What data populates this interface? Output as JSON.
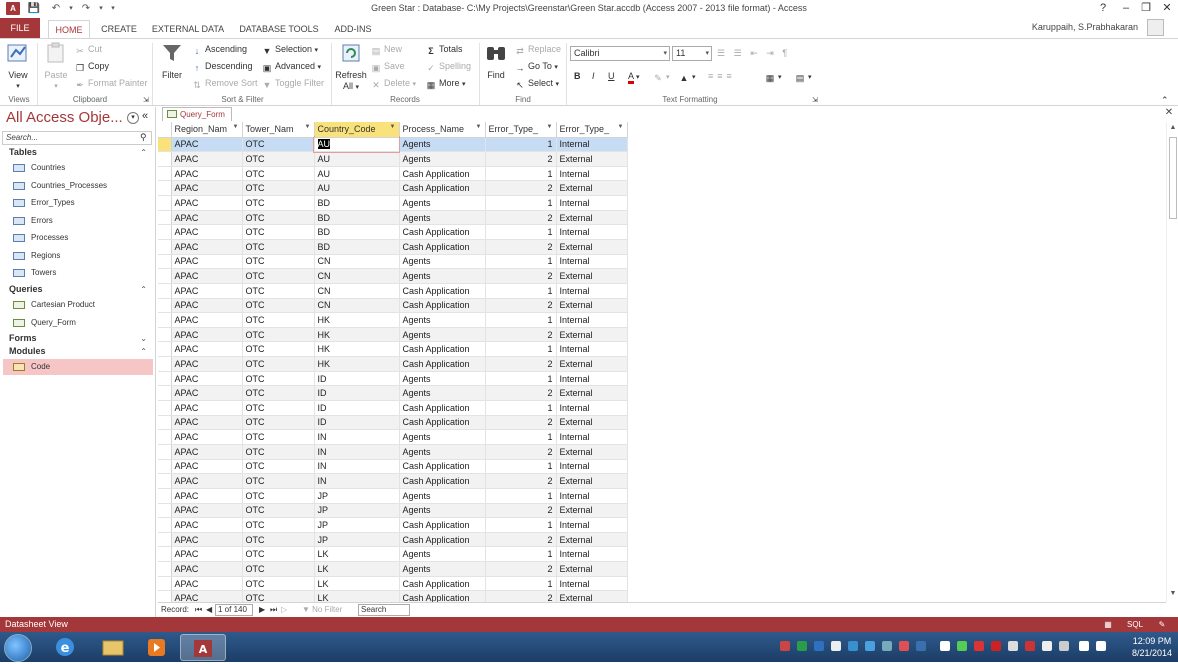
{
  "window": {
    "title": "Green Star : Database- C:\\My Projects\\Greenstar\\Green Star.accdb (Access 2007 - 2013 file format) - Access",
    "app_icon": "A",
    "help": "?",
    "user": "Karuppaih, S.Prabhakaran"
  },
  "tabs": [
    "FILE",
    "HOME",
    "CREATE",
    "EXTERNAL DATA",
    "DATABASE TOOLS",
    "ADD-INS"
  ],
  "ribbon": {
    "views": {
      "view": "View",
      "label": "Views"
    },
    "clipboard": {
      "paste": "Paste",
      "cut": "Cut",
      "copy": "Copy",
      "format_painter": "Format Painter",
      "label": "Clipboard"
    },
    "sort_filter": {
      "filter": "Filter",
      "ascending": "Ascending",
      "descending": "Descending",
      "remove_sort": "Remove Sort",
      "selection": "Selection",
      "advanced": "Advanced",
      "toggle_filter": "Toggle Filter",
      "label": "Sort & Filter"
    },
    "records": {
      "refresh": "Refresh",
      "refresh_all": "All",
      "new": "New",
      "save": "Save",
      "delete": "Delete",
      "totals": "Totals",
      "spelling": "Spelling",
      "more": "More",
      "label": "Records"
    },
    "find": {
      "find": "Find",
      "replace": "Replace",
      "goto": "Go To",
      "select": "Select",
      "label": "Find"
    },
    "text_formatting": {
      "font": "Calibri",
      "size": "11",
      "bold": "B",
      "italic": "I",
      "underline": "U",
      "font_color_letter": "A",
      "label": "Text Formatting"
    }
  },
  "nav": {
    "header": "All Access Obje...",
    "search_placeholder": "Search...",
    "sections": [
      {
        "title": "Tables",
        "items": [
          "Countries",
          "Countries_Processes",
          "Error_Types",
          "Errors",
          "Processes",
          "Regions",
          "Towers"
        ]
      },
      {
        "title": "Queries",
        "items": [
          "Cartesian Product",
          "Query_Form"
        ]
      },
      {
        "title": "Forms",
        "items": []
      },
      {
        "title": "Modules",
        "items": [
          "Code"
        ]
      }
    ]
  },
  "document_tab": "Query_Form",
  "grid": {
    "columns": [
      "Region_Nam",
      "Tower_Nam",
      "Country_Code",
      "Process_Name",
      "Error_Type_",
      "Error_Type_"
    ],
    "rows": [
      [
        "APAC",
        "OTC",
        "AU",
        "Agents",
        "1",
        "Internal"
      ],
      [
        "APAC",
        "OTC",
        "AU",
        "Agents",
        "2",
        "External"
      ],
      [
        "APAC",
        "OTC",
        "AU",
        "Cash Application",
        "1",
        "Internal"
      ],
      [
        "APAC",
        "OTC",
        "AU",
        "Cash Application",
        "2",
        "External"
      ],
      [
        "APAC",
        "OTC",
        "BD",
        "Agents",
        "1",
        "Internal"
      ],
      [
        "APAC",
        "OTC",
        "BD",
        "Agents",
        "2",
        "External"
      ],
      [
        "APAC",
        "OTC",
        "BD",
        "Cash Application",
        "1",
        "Internal"
      ],
      [
        "APAC",
        "OTC",
        "BD",
        "Cash Application",
        "2",
        "External"
      ],
      [
        "APAC",
        "OTC",
        "CN",
        "Agents",
        "1",
        "Internal"
      ],
      [
        "APAC",
        "OTC",
        "CN",
        "Agents",
        "2",
        "External"
      ],
      [
        "APAC",
        "OTC",
        "CN",
        "Cash Application",
        "1",
        "Internal"
      ],
      [
        "APAC",
        "OTC",
        "CN",
        "Cash Application",
        "2",
        "External"
      ],
      [
        "APAC",
        "OTC",
        "HK",
        "Agents",
        "1",
        "Internal"
      ],
      [
        "APAC",
        "OTC",
        "HK",
        "Agents",
        "2",
        "External"
      ],
      [
        "APAC",
        "OTC",
        "HK",
        "Cash Application",
        "1",
        "Internal"
      ],
      [
        "APAC",
        "OTC",
        "HK",
        "Cash Application",
        "2",
        "External"
      ],
      [
        "APAC",
        "OTC",
        "ID",
        "Agents",
        "1",
        "Internal"
      ],
      [
        "APAC",
        "OTC",
        "ID",
        "Agents",
        "2",
        "External"
      ],
      [
        "APAC",
        "OTC",
        "ID",
        "Cash Application",
        "1",
        "Internal"
      ],
      [
        "APAC",
        "OTC",
        "ID",
        "Cash Application",
        "2",
        "External"
      ],
      [
        "APAC",
        "OTC",
        "IN",
        "Agents",
        "1",
        "Internal"
      ],
      [
        "APAC",
        "OTC",
        "IN",
        "Agents",
        "2",
        "External"
      ],
      [
        "APAC",
        "OTC",
        "IN",
        "Cash Application",
        "1",
        "Internal"
      ],
      [
        "APAC",
        "OTC",
        "IN",
        "Cash Application",
        "2",
        "External"
      ],
      [
        "APAC",
        "OTC",
        "JP",
        "Agents",
        "1",
        "Internal"
      ],
      [
        "APAC",
        "OTC",
        "JP",
        "Agents",
        "2",
        "External"
      ],
      [
        "APAC",
        "OTC",
        "JP",
        "Cash Application",
        "1",
        "Internal"
      ],
      [
        "APAC",
        "OTC",
        "JP",
        "Cash Application",
        "2",
        "External"
      ],
      [
        "APAC",
        "OTC",
        "LK",
        "Agents",
        "1",
        "Internal"
      ],
      [
        "APAC",
        "OTC",
        "LK",
        "Agents",
        "2",
        "External"
      ],
      [
        "APAC",
        "OTC",
        "LK",
        "Cash Application",
        "1",
        "Internal"
      ],
      [
        "APAC",
        "OTC",
        "LK",
        "Cash Application",
        "2",
        "External"
      ]
    ]
  },
  "record_nav": {
    "label": "Record:",
    "position": "1 of 140",
    "filter": "No Filter",
    "search": "Search"
  },
  "status": {
    "text": "Datasheet View",
    "sql": "SQL"
  },
  "taskbar": {
    "time": "12:09 PM",
    "date": "8/21/2014"
  },
  "colors": {
    "accent": "#a4373a",
    "selected_header": "#f9e27b",
    "current_row": "#c6dcf4",
    "nav_selected": "#f6c6c6"
  }
}
